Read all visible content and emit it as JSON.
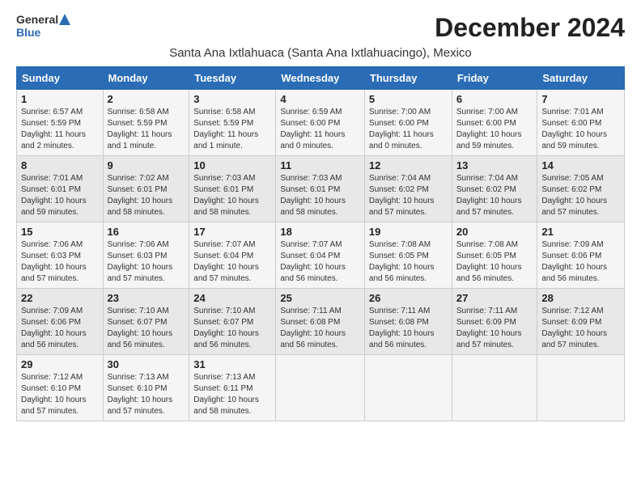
{
  "logo": {
    "general": "General",
    "blue": "Blue"
  },
  "title": "December 2024",
  "location": "Santa Ana Ixtlahuaca (Santa Ana Ixtlahuacingo), Mexico",
  "days_of_week": [
    "Sunday",
    "Monday",
    "Tuesday",
    "Wednesday",
    "Thursday",
    "Friday",
    "Saturday"
  ],
  "weeks": [
    [
      {
        "day": "1",
        "sunrise": "6:57 AM",
        "sunset": "5:59 PM",
        "daylight": "11 hours and 2 minutes"
      },
      {
        "day": "2",
        "sunrise": "6:58 AM",
        "sunset": "5:59 PM",
        "daylight": "11 hours and 1 minute"
      },
      {
        "day": "3",
        "sunrise": "6:58 AM",
        "sunset": "5:59 PM",
        "daylight": "11 hours and 1 minute"
      },
      {
        "day": "4",
        "sunrise": "6:59 AM",
        "sunset": "6:00 PM",
        "daylight": "11 hours and 0 minutes"
      },
      {
        "day": "5",
        "sunrise": "7:00 AM",
        "sunset": "6:00 PM",
        "daylight": "11 hours and 0 minutes"
      },
      {
        "day": "6",
        "sunrise": "7:00 AM",
        "sunset": "6:00 PM",
        "daylight": "10 hours and 59 minutes"
      },
      {
        "day": "7",
        "sunrise": "7:01 AM",
        "sunset": "6:00 PM",
        "daylight": "10 hours and 59 minutes"
      }
    ],
    [
      {
        "day": "8",
        "sunrise": "7:01 AM",
        "sunset": "6:01 PM",
        "daylight": "10 hours and 59 minutes"
      },
      {
        "day": "9",
        "sunrise": "7:02 AM",
        "sunset": "6:01 PM",
        "daylight": "10 hours and 58 minutes"
      },
      {
        "day": "10",
        "sunrise": "7:03 AM",
        "sunset": "6:01 PM",
        "daylight": "10 hours and 58 minutes"
      },
      {
        "day": "11",
        "sunrise": "7:03 AM",
        "sunset": "6:01 PM",
        "daylight": "10 hours and 58 minutes"
      },
      {
        "day": "12",
        "sunrise": "7:04 AM",
        "sunset": "6:02 PM",
        "daylight": "10 hours and 57 minutes"
      },
      {
        "day": "13",
        "sunrise": "7:04 AM",
        "sunset": "6:02 PM",
        "daylight": "10 hours and 57 minutes"
      },
      {
        "day": "14",
        "sunrise": "7:05 AM",
        "sunset": "6:02 PM",
        "daylight": "10 hours and 57 minutes"
      }
    ],
    [
      {
        "day": "15",
        "sunrise": "7:06 AM",
        "sunset": "6:03 PM",
        "daylight": "10 hours and 57 minutes"
      },
      {
        "day": "16",
        "sunrise": "7:06 AM",
        "sunset": "6:03 PM",
        "daylight": "10 hours and 57 minutes"
      },
      {
        "day": "17",
        "sunrise": "7:07 AM",
        "sunset": "6:04 PM",
        "daylight": "10 hours and 57 minutes"
      },
      {
        "day": "18",
        "sunrise": "7:07 AM",
        "sunset": "6:04 PM",
        "daylight": "10 hours and 56 minutes"
      },
      {
        "day": "19",
        "sunrise": "7:08 AM",
        "sunset": "6:05 PM",
        "daylight": "10 hours and 56 minutes"
      },
      {
        "day": "20",
        "sunrise": "7:08 AM",
        "sunset": "6:05 PM",
        "daylight": "10 hours and 56 minutes"
      },
      {
        "day": "21",
        "sunrise": "7:09 AM",
        "sunset": "6:06 PM",
        "daylight": "10 hours and 56 minutes"
      }
    ],
    [
      {
        "day": "22",
        "sunrise": "7:09 AM",
        "sunset": "6:06 PM",
        "daylight": "10 hours and 56 minutes"
      },
      {
        "day": "23",
        "sunrise": "7:10 AM",
        "sunset": "6:07 PM",
        "daylight": "10 hours and 56 minutes"
      },
      {
        "day": "24",
        "sunrise": "7:10 AM",
        "sunset": "6:07 PM",
        "daylight": "10 hours and 56 minutes"
      },
      {
        "day": "25",
        "sunrise": "7:11 AM",
        "sunset": "6:08 PM",
        "daylight": "10 hours and 56 minutes"
      },
      {
        "day": "26",
        "sunrise": "7:11 AM",
        "sunset": "6:08 PM",
        "daylight": "10 hours and 56 minutes"
      },
      {
        "day": "27",
        "sunrise": "7:11 AM",
        "sunset": "6:09 PM",
        "daylight": "10 hours and 57 minutes"
      },
      {
        "day": "28",
        "sunrise": "7:12 AM",
        "sunset": "6:09 PM",
        "daylight": "10 hours and 57 minutes"
      }
    ],
    [
      {
        "day": "29",
        "sunrise": "7:12 AM",
        "sunset": "6:10 PM",
        "daylight": "10 hours and 57 minutes"
      },
      {
        "day": "30",
        "sunrise": "7:13 AM",
        "sunset": "6:10 PM",
        "daylight": "10 hours and 57 minutes"
      },
      {
        "day": "31",
        "sunrise": "7:13 AM",
        "sunset": "6:11 PM",
        "daylight": "10 hours and 58 minutes"
      },
      null,
      null,
      null,
      null
    ]
  ]
}
